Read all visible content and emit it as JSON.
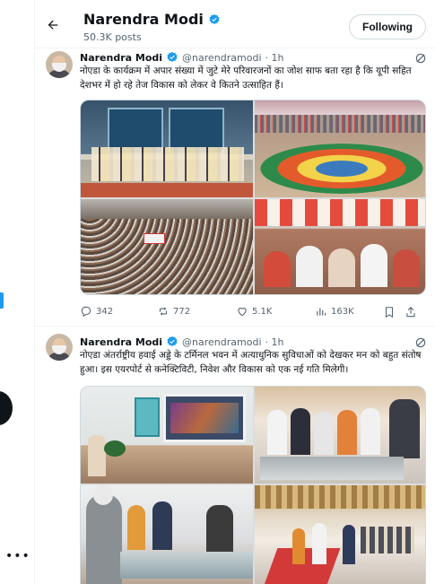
{
  "header": {
    "name": "Narendra Modi",
    "posts": "50.3K posts",
    "follow_label": "Following"
  },
  "tweets": [
    {
      "name": "Narendra Modi",
      "handle": "@narendramodi",
      "time": "· 1h",
      "text": "नोएडा के कार्यक्रम में अपार संख्या में जुटे मेरे परिवारजनों का जोश साफ बता रहा है कि यूपी सहित देशभर में हो रहे तेज विकास को लेकर वे कितने उत्साहित हैं।",
      "replies": "342",
      "reposts": "772",
      "likes": "5.1K",
      "views": "163K"
    },
    {
      "name": "Narendra Modi",
      "handle": "@narendramodi",
      "time": "· 1h",
      "text": "नोएडा अंतर्राष्ट्रीय हवाई अड्डे के टर्मिनल भवन में अत्याधुनिक सुविधाओं को देखकर मन को बहुत संतोष हुआ। इस एयरपोर्ट से कनेक्टिविटी, निवेश और विकास को एक नई गति मिलेगी।"
    }
  ],
  "icons": {
    "verified_color": "#1d9bf0",
    "accent": "#1d9bf0"
  }
}
